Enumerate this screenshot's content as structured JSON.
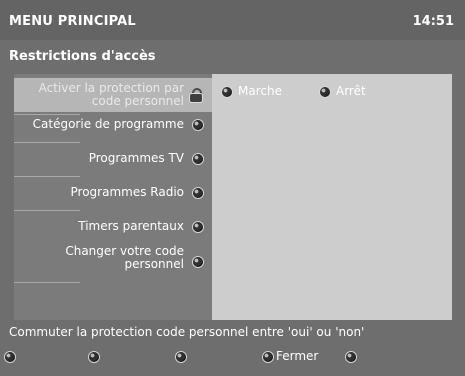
{
  "header": {
    "title": "MENU PRINCIPAL",
    "time": "14:51"
  },
  "section": {
    "title": "Restrictions d'accès"
  },
  "menu": {
    "items": [
      {
        "label": "Activer la protection par code personnel",
        "icon": "lock-icon"
      },
      {
        "label": "Catégorie de programme",
        "icon": "knob-icon"
      },
      {
        "label": "Programmes TV",
        "icon": "knob-icon"
      },
      {
        "label": "Programmes Radio",
        "icon": "knob-icon"
      },
      {
        "label": "Timers parentaux",
        "icon": "knob-icon"
      },
      {
        "label": "Changer votre code personnel",
        "icon": "knob-icon"
      }
    ]
  },
  "options": {
    "on_label": "Marche",
    "off_label": "Arrêt"
  },
  "help": {
    "text": "Commuter la protection code personnel entre  'oui' ou 'non'"
  },
  "footer": {
    "buttons": [
      {
        "label": ""
      },
      {
        "label": ""
      },
      {
        "label": ""
      },
      {
        "label": "Fermer"
      },
      {
        "label": ""
      }
    ]
  }
}
